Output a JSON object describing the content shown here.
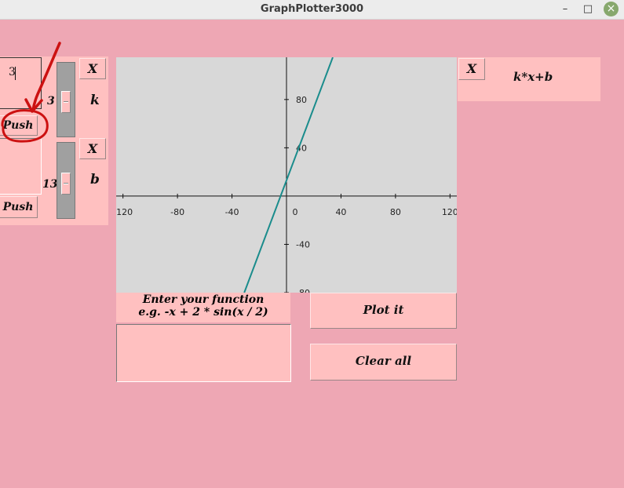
{
  "window": {
    "title": "GraphPlotter3000",
    "minimize_glyph": "–",
    "maximize_glyph": "□",
    "close_glyph": "×"
  },
  "left": {
    "entry_value": "3",
    "push_label_1": "Push",
    "push_label_2": "Push"
  },
  "params": [
    {
      "remove_label": "X",
      "name": "k",
      "value": "3"
    },
    {
      "remove_label": "X",
      "name": "b",
      "value": "13"
    }
  ],
  "functions": [
    {
      "remove_label": "X",
      "expression": "k*x+b"
    }
  ],
  "input": {
    "prompt_line1": "Enter your function",
    "prompt_line2": "e.g. -x + 2 * sin(x / 2)",
    "value": ""
  },
  "buttons": {
    "plot_label": "Plot it",
    "clear_label": "Clear all"
  },
  "annotation": {
    "color": "#cc1111",
    "icons": [
      "arrow-annotation-icon",
      "circle-annotation-icon"
    ]
  },
  "chart_data": {
    "type": "line",
    "title": "",
    "xlabel": "",
    "ylabel": "",
    "xlim": [
      -125,
      125
    ],
    "ylim": [
      -80,
      115
    ],
    "xticks": [
      -120,
      -80,
      -40,
      0,
      40,
      80,
      120
    ],
    "yticks": [
      -80,
      -40,
      40,
      80
    ],
    "grid": false,
    "series": [
      {
        "color": "#1a8c8c",
        "x": [
          -31,
          34
        ],
        "y": [
          -80,
          115
        ]
      }
    ]
  }
}
